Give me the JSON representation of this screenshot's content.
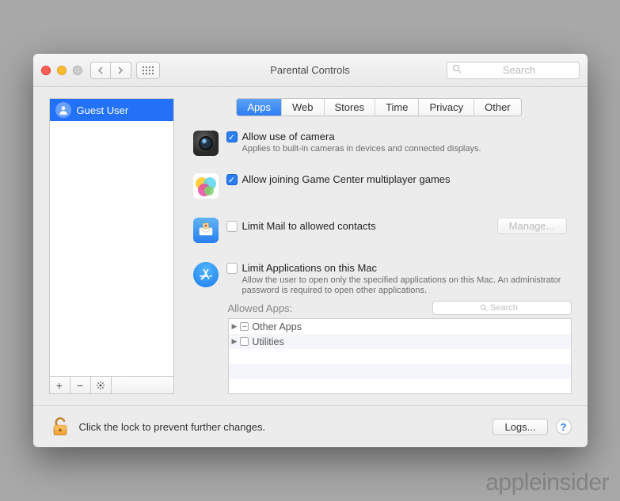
{
  "window": {
    "title": "Parental Controls"
  },
  "search": {
    "placeholder": "Search"
  },
  "sidebar": {
    "users": [
      {
        "name": "Guest User"
      }
    ]
  },
  "tabs": [
    {
      "label": "Apps",
      "active": true
    },
    {
      "label": "Web"
    },
    {
      "label": "Stores"
    },
    {
      "label": "Time"
    },
    {
      "label": "Privacy"
    },
    {
      "label": "Other"
    }
  ],
  "sections": {
    "camera": {
      "checked": true,
      "label": "Allow use of camera",
      "desc": "Applies to built-in cameras in devices and connected displays."
    },
    "gamecenter": {
      "checked": true,
      "label": "Allow joining Game Center multiplayer games"
    },
    "mail": {
      "checked": false,
      "label": "Limit Mail to allowed contacts",
      "manage_btn": "Manage..."
    },
    "apps": {
      "checked": false,
      "label": "Limit Applications on this Mac",
      "desc": "Allow the user to open only the specified applications on this Mac. An administrator password is required to open other applications.",
      "allowed_label": "Allowed Apps:",
      "search_placeholder": "Search",
      "tree": [
        {
          "label": "Other Apps",
          "indeterminate": true
        },
        {
          "label": "Utilities",
          "indeterminate": false
        }
      ]
    }
  },
  "footer": {
    "lock_text": "Click the lock to prevent further changes.",
    "logs_btn": "Logs..."
  },
  "watermark": "appleinsider"
}
